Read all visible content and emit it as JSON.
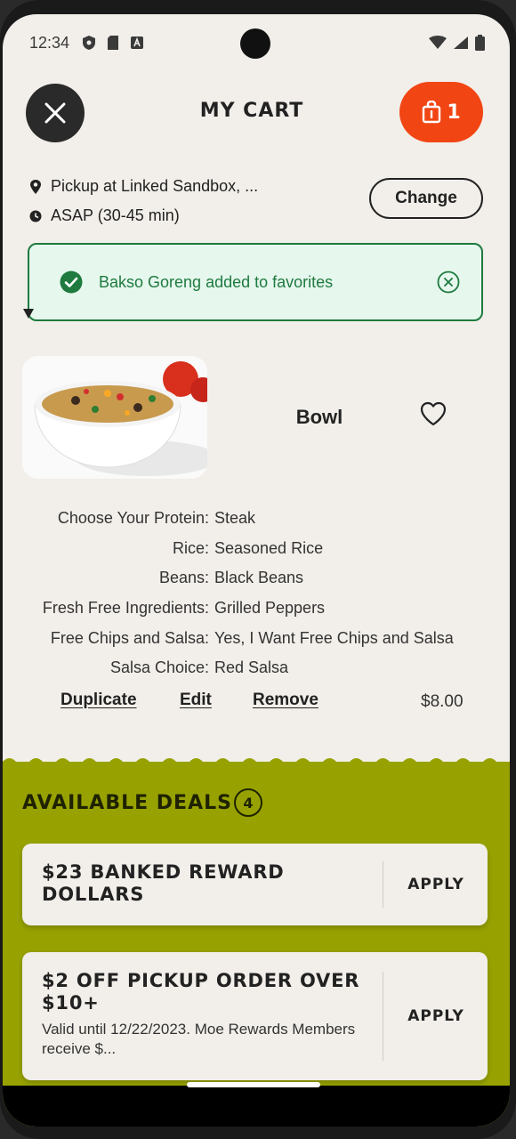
{
  "status_bar": {
    "time": "12:34"
  },
  "header": {
    "title": "MY CART",
    "cart_count": "1"
  },
  "pickup": {
    "location": "Pickup at Linked Sandbox, ...",
    "time": "ASAP (30-45 min)",
    "change_label": "Change"
  },
  "toast": {
    "message": "Bakso Goreng added to favorites"
  },
  "item": {
    "name": "Bowl",
    "modifiers": [
      {
        "key": "Choose Your Protein:",
        "value": "Steak"
      },
      {
        "key": "Rice:",
        "value": "Seasoned Rice"
      },
      {
        "key": "Beans:",
        "value": "Black Beans"
      },
      {
        "key": "Fresh Free Ingredients:",
        "value": "Grilled Peppers"
      },
      {
        "key": "Free Chips and Salsa:",
        "value": "Yes, I Want Free Chips and Salsa"
      },
      {
        "key": "Salsa Choice:",
        "value": "Red Salsa"
      }
    ],
    "actions": {
      "duplicate": "Duplicate",
      "edit": "Edit",
      "remove": "Remove"
    },
    "price": "$8.00"
  },
  "deals": {
    "title": "AVAILABLE DEALS",
    "count": "4",
    "items": [
      {
        "title": "$23 BANKED REWARD DOLLARS",
        "description": "",
        "apply_label": "APPLY"
      },
      {
        "title": "$2 OFF PICKUP ORDER OVER $10+",
        "description": "Valid until 12/22/2023. Moe Rewards Members receive $...",
        "apply_label": "APPLY"
      }
    ]
  },
  "colors": {
    "cart_button": "#f24514",
    "toast_border": "#1e7a3e",
    "deals_background": "#97a200"
  }
}
